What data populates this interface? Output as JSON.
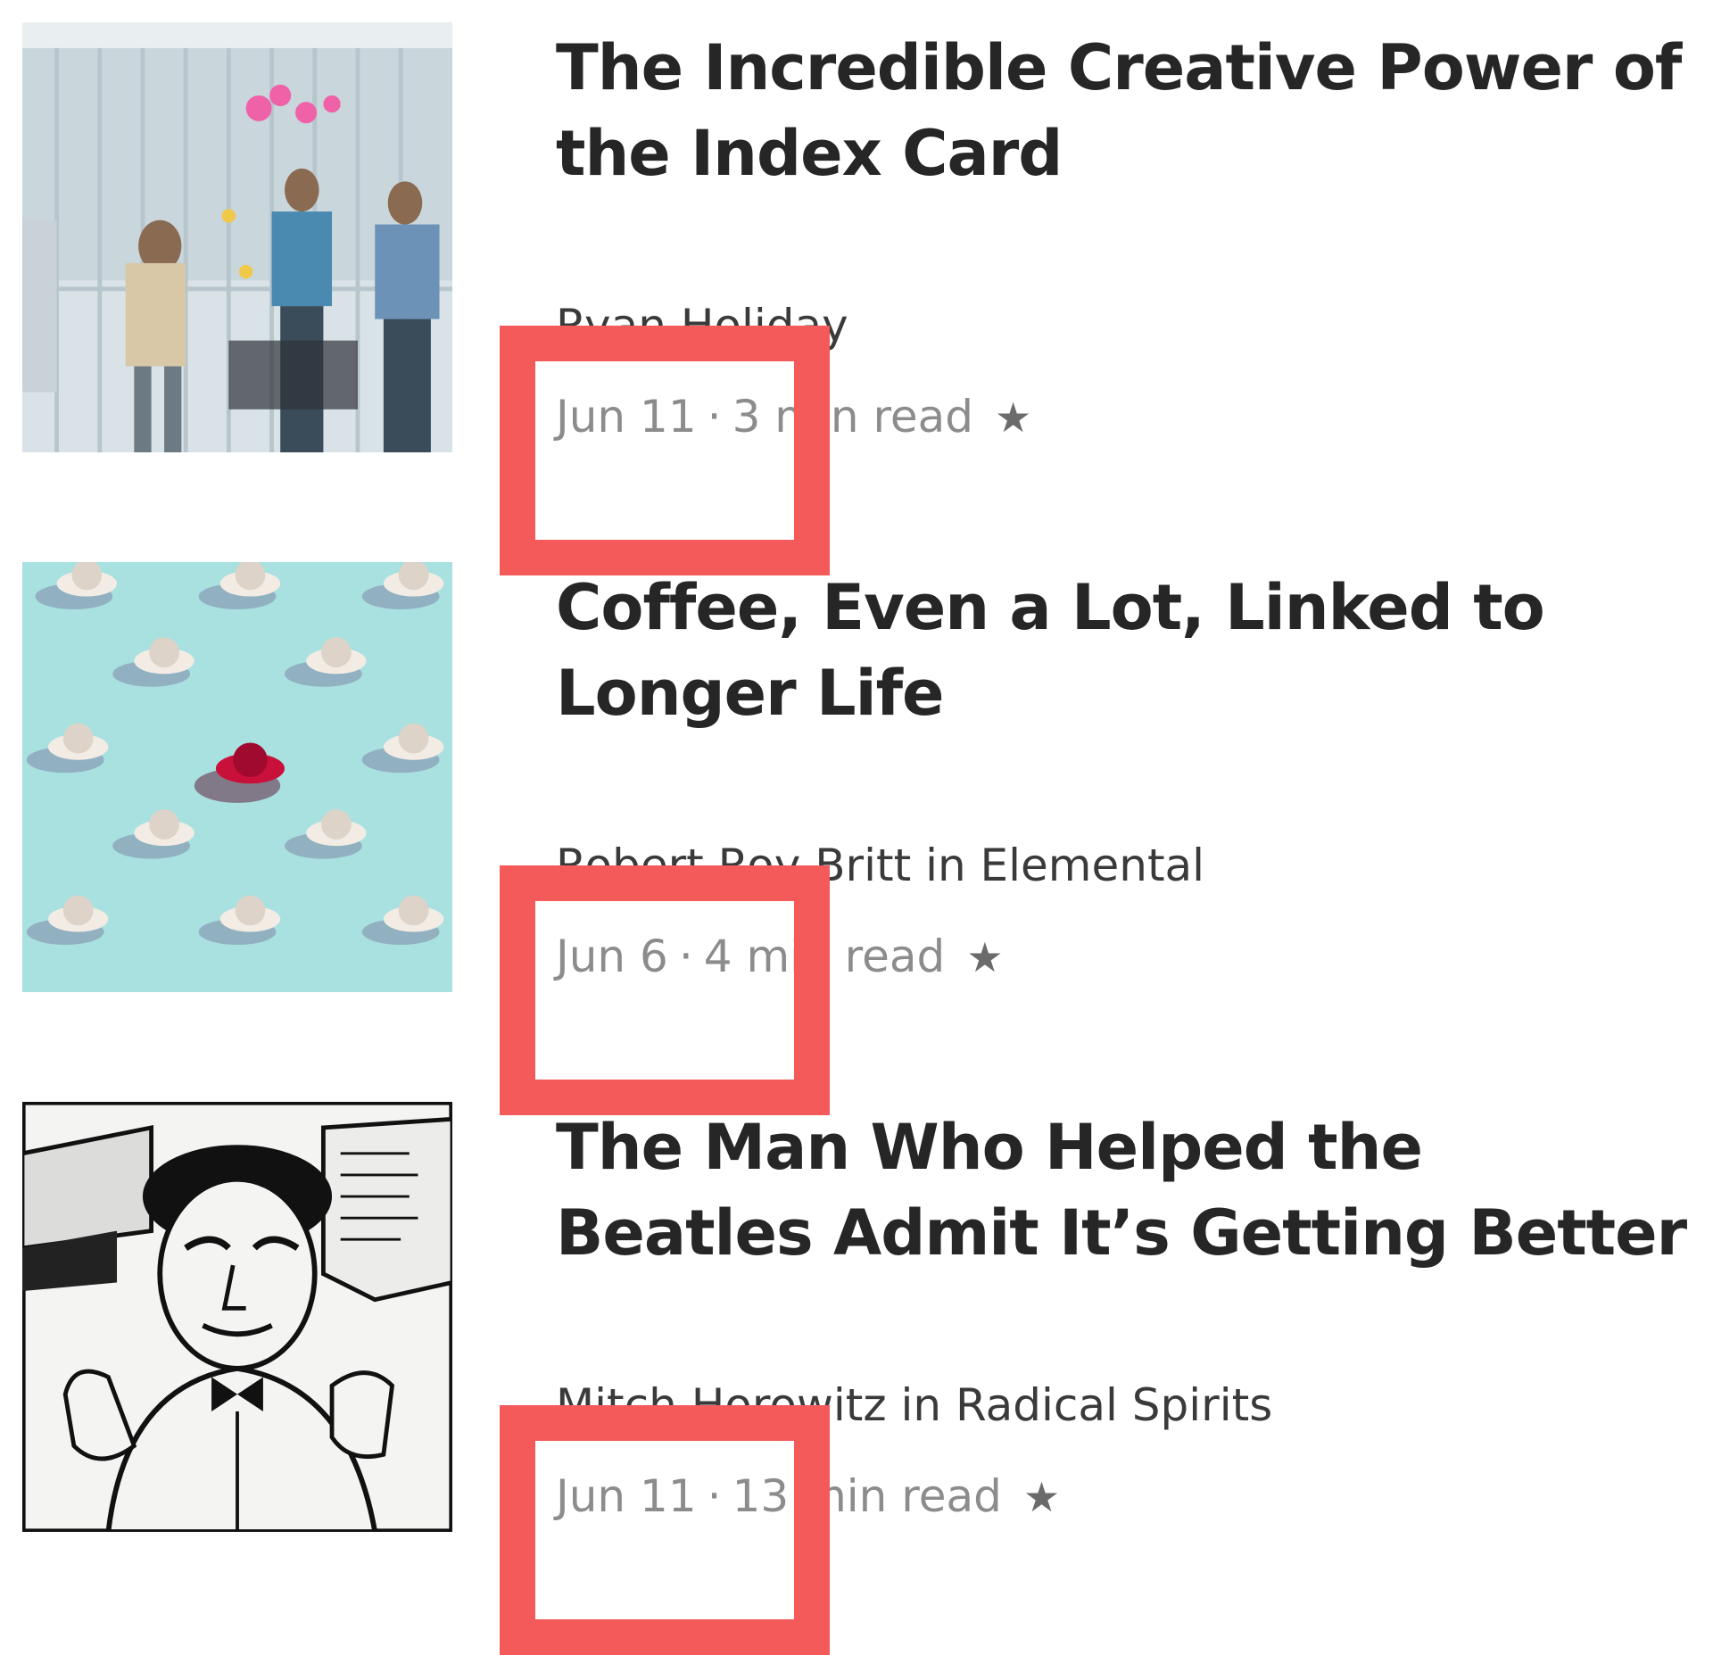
{
  "articles": [
    {
      "title": "The Incredible Creative Power of the Index Card",
      "author_line": "Ryan Holiday",
      "date": "Jun 11",
      "separator": "·",
      "read_time": "3 min read",
      "star": "★",
      "thumbnail": "office-team-sticky-notes-photo"
    },
    {
      "title": "Coffee, Even a Lot, Linked to Longer Life",
      "author_line": "Robert Roy Britt in Elemental",
      "date": "Jun 6",
      "separator": "·",
      "read_time": "4 min read",
      "star": "★",
      "thumbnail": "teacups-on-blue-photo"
    },
    {
      "title": "The Man Who Helped the Beatles Admit It’s Getting Better",
      "author_line": "Mitch Horowitz in Radical Spirits",
      "date": "Jun 11",
      "separator": "·",
      "read_time": "13 min read",
      "star": "★",
      "thumbnail": "vintage-man-illustration"
    }
  ],
  "colors": {
    "title": "#262626",
    "author": "#3a3a3a",
    "meta": "#8c8c8c",
    "highlight": "#f45a5a"
  }
}
